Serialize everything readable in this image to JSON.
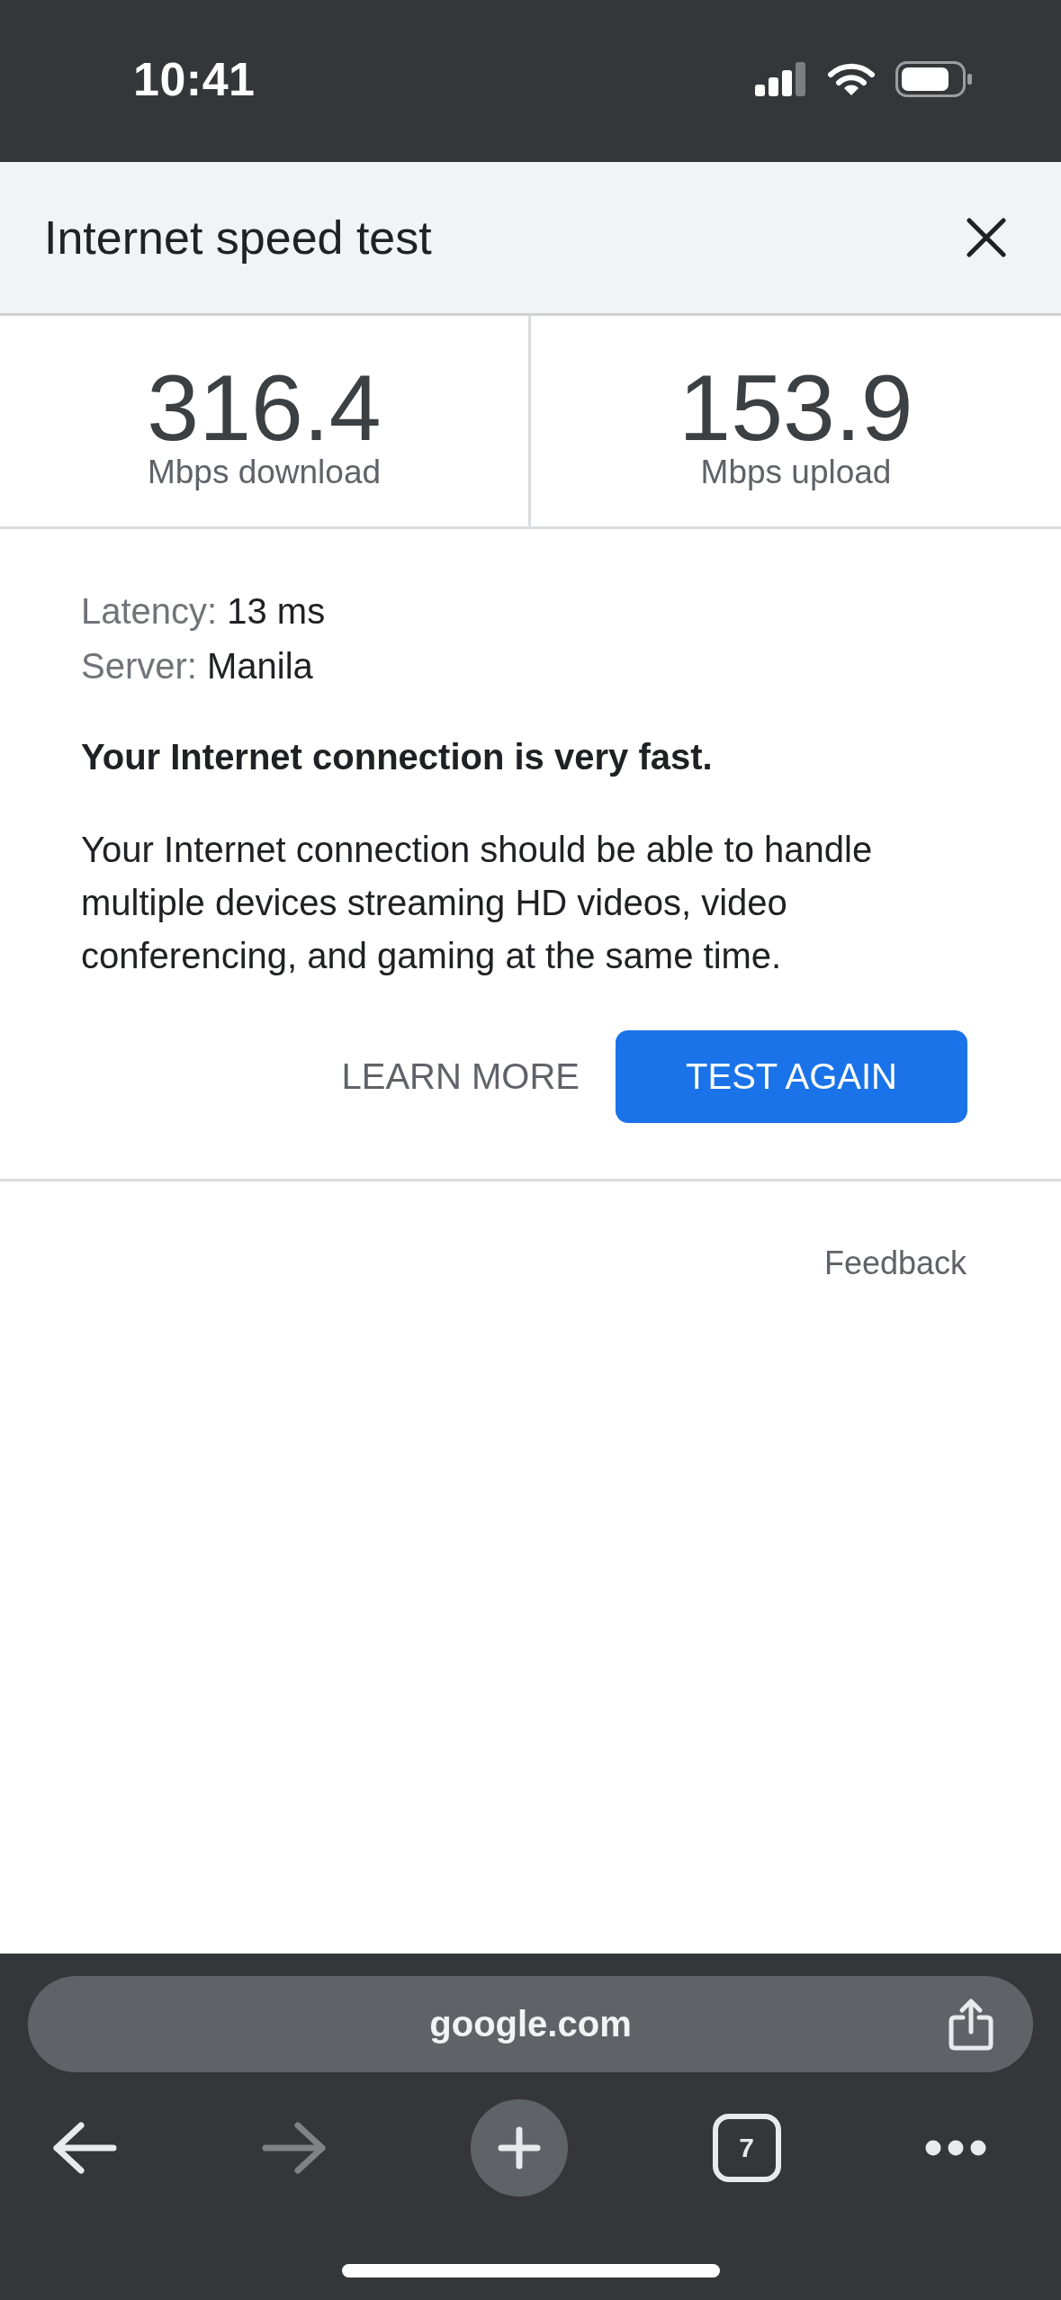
{
  "status_bar": {
    "time": "10:41"
  },
  "header": {
    "title": "Internet speed test"
  },
  "results": [
    {
      "value": "316.4",
      "label": "Mbps download"
    },
    {
      "value": "153.9",
      "label": "Mbps upload"
    }
  ],
  "details": [
    {
      "label": "Latency:",
      "value": "13 ms"
    },
    {
      "label": "Server:",
      "value": "Manila"
    }
  ],
  "summary": {
    "headline": "Your Internet connection is very fast.",
    "description": "Your Internet connection should be able to handle multiple devices streaming HD videos, video conferencing, and gaming at the same time."
  },
  "actions": [
    {
      "label": "LEARN MORE",
      "kind": "text"
    },
    {
      "label": "TEST AGAIN",
      "kind": "filled"
    }
  ],
  "feedback": {
    "label": "Feedback"
  },
  "browser_bar": {
    "url": "google.com",
    "nav": [
      {
        "kind": "back",
        "disabled": false
      },
      {
        "kind": "forward",
        "disabled": true
      },
      {
        "kind": "new_tab",
        "disabled": false
      },
      {
        "kind": "tabs",
        "count": "7",
        "disabled": false
      },
      {
        "kind": "more",
        "disabled": false
      }
    ]
  }
}
